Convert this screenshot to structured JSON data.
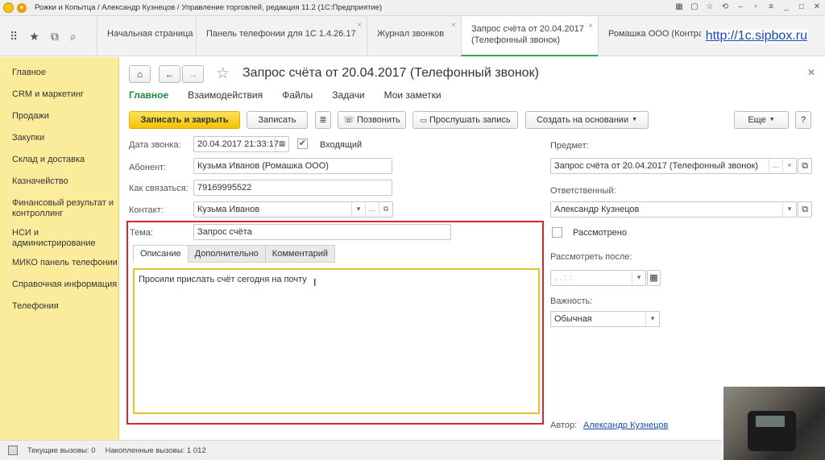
{
  "window": {
    "title": "Рожки и Копытца / Александр Кузнецов / Управление торговлей, редакция 11.2  (1С:Предприятие)"
  },
  "tabs": [
    {
      "label": "Начальная страница",
      "closable": false
    },
    {
      "label": "Панель телефонии для 1С 1.4.26.17",
      "closable": true
    },
    {
      "label": "Журнал звонков",
      "closable": true
    },
    {
      "label": "Запрос счёта от 20.04.2017",
      "label2": "(Телефонный звонок)",
      "closable": true,
      "active": true
    },
    {
      "label": "Ромашка ООО (Контраге",
      "closable": false
    }
  ],
  "watermark": "http://1c.sipbox.ru",
  "sidebar": {
    "items": [
      {
        "label": "Главное"
      },
      {
        "label": "CRM и маркетинг"
      },
      {
        "label": "Продажи"
      },
      {
        "label": "Закупки"
      },
      {
        "label": "Склад и доставка"
      },
      {
        "label": "Казначейство"
      },
      {
        "label": "Финансовый результат и контроллинг"
      },
      {
        "label": "НСИ и администрирование"
      },
      {
        "label": "МИКО панель телефонии"
      },
      {
        "label": "Справочная информация"
      },
      {
        "label": "Телефония"
      }
    ]
  },
  "form": {
    "title": "Запрос счёта от 20.04.2017 (Телефонный звонок)",
    "subnav": [
      "Главное",
      "Взаимодействия",
      "Файлы",
      "Задачи",
      "Мои заметки"
    ],
    "toolbar": {
      "save_close": "Записать и закрыть",
      "save": "Записать",
      "call": "Позвонить",
      "listen": "Прослушать запись",
      "create_based": "Создать на основании",
      "more": "Еще",
      "help": "?"
    },
    "fields": {
      "call_date_label": "Дата звонка:",
      "call_date_value": "20.04.2017 21:33:17",
      "incoming_label": "Входящий",
      "incoming_checked": true,
      "subscriber_label": "Абонент:",
      "subscriber_value": "Кузьма Иванов (Ромашка ООО)",
      "how_to_contact_label": "Как связаться:",
      "how_to_contact_value": "79169995522",
      "contact_label": "Контакт:",
      "contact_value": "Кузьма Иванов",
      "topic_label": "Тема:",
      "topic_value": "Запрос счёта"
    },
    "inner_tabs": [
      "Описание",
      "Дополнительно",
      "Комментарий"
    ],
    "description": "Просили прислать счёт сегодня на почту",
    "right": {
      "subject_label": "Предмет:",
      "subject_value": "Запрос счёта от 20.04.2017 (Телефонный звонок)",
      "responsible_label": "Ответственный:",
      "responsible_value": "Александр Кузнецов",
      "reviewed_label": "Рассмотрено",
      "reviewed_checked": false,
      "review_after_label": "Рассмотреть после:",
      "review_after_value": "  .  .         :  :",
      "importance_label": "Важность:",
      "importance_value": "Обычная",
      "author_label": "Автор:",
      "author_value": "Александр Кузнецов"
    }
  },
  "status": {
    "current_calls": "Текущие вызовы: 0",
    "accumulated_calls": "Накопленные вызовы: 1 012"
  }
}
